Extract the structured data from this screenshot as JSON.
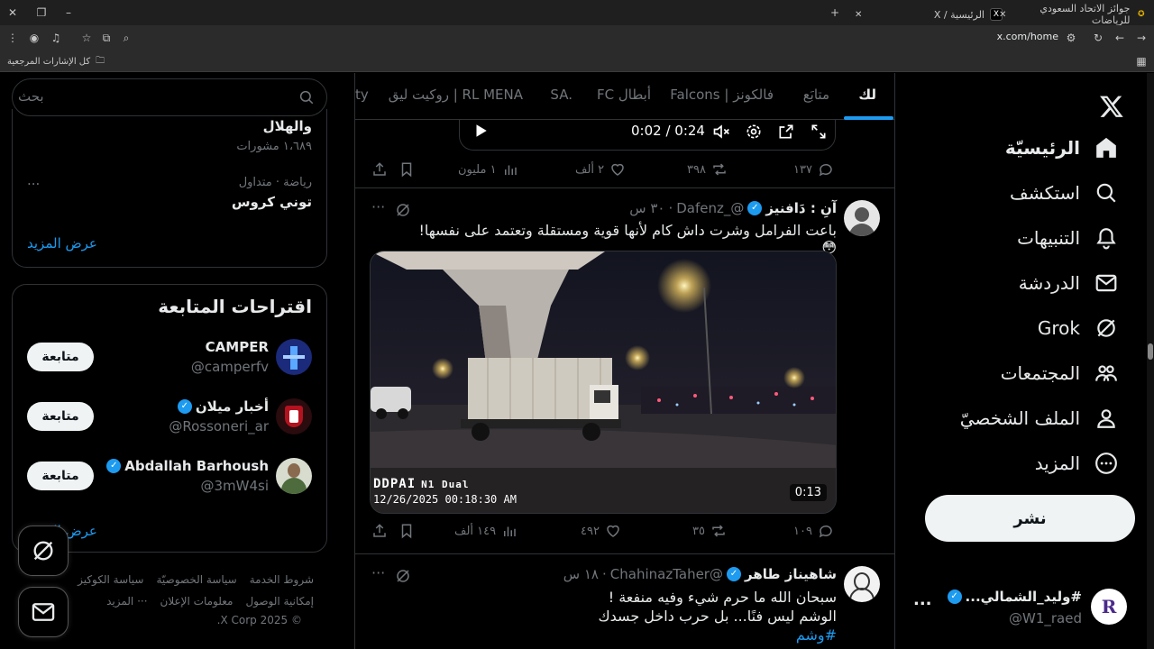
{
  "browser": {
    "tabs": [
      {
        "title": "جوائز الاتحاد السعودي للرياضات",
        "active": false
      },
      {
        "title": "الرئيسية / X",
        "active": true
      }
    ],
    "new_tab": "+",
    "url": "x.com/home",
    "bookmarks_label": "كل الإشارات المرجعية"
  },
  "nav": {
    "items": [
      {
        "label": "الرئيسيّة",
        "icon": "home-icon"
      },
      {
        "label": "استكشف",
        "icon": "search-icon"
      },
      {
        "label": "التنبيهات",
        "icon": "bell-icon"
      },
      {
        "label": "الدردشة",
        "icon": "mail-icon"
      },
      {
        "label": "Grok",
        "icon": "grok-icon"
      },
      {
        "label": "المجتمعات",
        "icon": "communities-icon"
      },
      {
        "label": "الملف الشخصيّ",
        "icon": "person-icon"
      },
      {
        "label": "المزيد",
        "icon": "more-icon"
      }
    ],
    "post_button": "نشر",
    "account": {
      "name": "#وليد_الشمالي...",
      "handle": "@W1_raed",
      "avatar_letter": "R",
      "more": "..."
    }
  },
  "feed": {
    "tabs": [
      "لك",
      "متابَع",
      "فالكونز | Falcons",
      "أبطال FC",
      "SA.",
      "RL MENA | روكيت ليق",
      "ty"
    ],
    "video_player": {
      "time": "0:02 / 0:24"
    },
    "first_actions": {
      "replies": "١٣٧",
      "reposts": "٣٩٨",
      "likes": "٢ ألف",
      "views": "١ مليون"
    },
    "tweets": [
      {
        "name": "آنِ : دَافنيز",
        "handle": "@_Dafenz",
        "time": "٣٠ س",
        "text": "باعت الفرامل وشرت داش كام لأنها قوية ومستقلة وتعتمد على نفسها! 😳",
        "media": {
          "brand": "DDPAI",
          "model": "N1 Dual",
          "timestamp": "12/26/2025 00:18:30 AM",
          "duration": "0:13"
        },
        "replies": "١٠٩",
        "reposts": "٣٥",
        "likes": "٤٩٢",
        "views": "١٤٩ ألف"
      },
      {
        "name": "شاهيناز طاهر",
        "handle": "@ChahinazTaher",
        "time": "١٨ س",
        "line1": "سبحان الله ما حرم شيء وفيه منفعة !",
        "line2": "الوشم ليس فنًا... بل حرب داخل جسدك",
        "hashtag": "#وشم"
      }
    ]
  },
  "sidebar": {
    "search_placeholder": "بحث",
    "trends": [
      {
        "title": "والهلال",
        "meta": "١،٦٨٩ مشورات"
      },
      {
        "category": "رياضة · متداول",
        "title": "توني كروس",
        "more": "..."
      }
    ],
    "show_more": "عرض المزيد",
    "who_to_follow": {
      "title": "اقتراحات المتابعة",
      "users": [
        {
          "name": "CAMPER",
          "handle": "@camperfv",
          "button": "متابعة",
          "verified": false
        },
        {
          "name": "أخبار ميلان",
          "handle": "@Rossoneri_ar",
          "button": "متابعة",
          "verified": true
        },
        {
          "name": "Abdallah Barhoush",
          "handle": "@3mW4si",
          "button": "متابعة",
          "verified": true
        }
      ],
      "show_more": "عرض المزيد"
    },
    "footer": {
      "links1": [
        "شروط الخدمة",
        "سياسة الخصوصيّة",
        "سياسة الكوكيز"
      ],
      "links2": [
        "إمكانية الوصول",
        "معلومات الإعلان",
        "··· المزيد"
      ],
      "copyright": "© 2025 X Corp."
    }
  },
  "colors": {
    "accent": "#1d9bf0",
    "bg": "#000000",
    "border": "#2f3336",
    "muted": "#71767b"
  }
}
